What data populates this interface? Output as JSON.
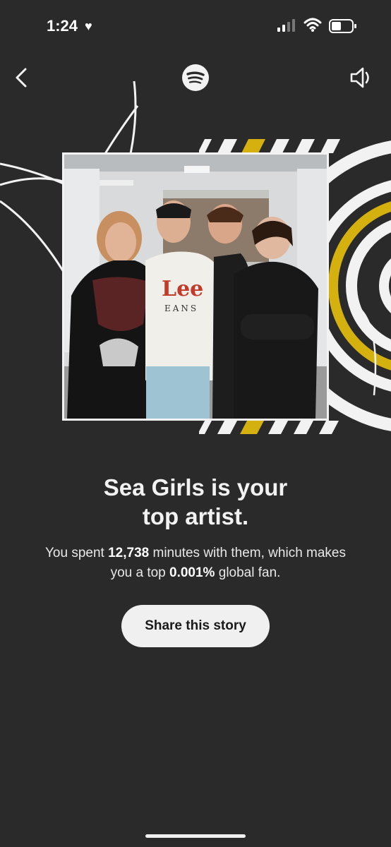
{
  "status_bar": {
    "time": "1:24",
    "heart_icon": "heart-icon",
    "signal_icon": "cellular-signal-icon",
    "wifi_icon": "wifi-icon",
    "battery_icon": "battery-icon"
  },
  "nav": {
    "back_icon": "chevron-left-icon",
    "logo_icon": "spotify-logo-icon",
    "sound_icon": "speaker-icon"
  },
  "story": {
    "headline_line1": "Sea Girls is your",
    "headline_line2": "top artist.",
    "body_prefix": "You spent ",
    "minutes": "12,738",
    "body_middle": " minutes with them, which makes",
    "body_line2_prefix": "you a top ",
    "percent": "0.001%",
    "body_suffix": " global fan.",
    "share_label": "Share this story"
  },
  "photo": {
    "lettering_shirt": "Lee",
    "lettering_shirt_sub": "EANS"
  },
  "colors": {
    "background": "#2a2a2a",
    "accent_yellow": "#d4b10f",
    "text": "#f2f2f2",
    "button_bg": "#f0f0f0"
  }
}
